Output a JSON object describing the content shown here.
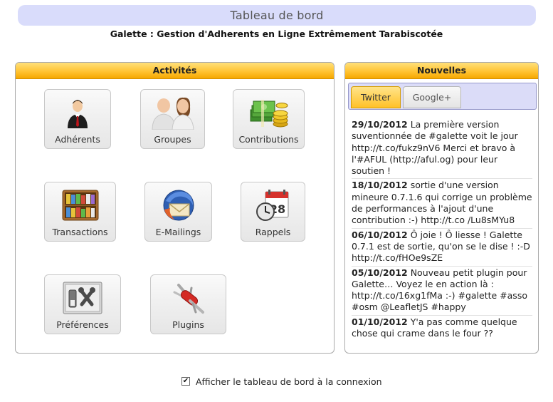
{
  "page": {
    "title": "Tableau de bord",
    "subtitle": "Galette : Gestion d'Adherents en Ligne Extrêmement Tarabiscotée"
  },
  "activities": {
    "title": "Activités",
    "tiles": [
      {
        "label": "Adhérents",
        "icon": "member-icon"
      },
      {
        "label": "Groupes",
        "icon": "groups-icon"
      },
      {
        "label": "Contributions",
        "icon": "contributions-icon"
      },
      {
        "label": "Transactions",
        "icon": "transactions-icon"
      },
      {
        "label": "E-Mailings",
        "icon": "email-icon"
      },
      {
        "label": "Rappels",
        "icon": "calendar-clock-icon"
      },
      {
        "label": "Préférences",
        "icon": "preferences-icon"
      },
      {
        "label": "Plugins",
        "icon": "plugins-icon"
      }
    ]
  },
  "news": {
    "title": "Nouvelles",
    "tabs": [
      {
        "label": "Twitter",
        "active": true
      },
      {
        "label": "Google+",
        "active": false
      }
    ],
    "items": [
      {
        "date": "29/10/2012",
        "text": "La première version suventionnée de #galette voit le jour http://t.co/fukz9nV6 Merci et bravo à l'#AFUL (http://aful.og) pour leur soutien !"
      },
      {
        "date": "18/10/2012",
        "text": "sortie d'une version mineure 0.7.1.6 qui corrige un problème de performances à l'ajout d'une contribution :-) http://t.co /Lu8sMYu8"
      },
      {
        "date": "06/10/2012",
        "text": "Ô joie ! Ô liesse ! Galette 0.7.1 est de sortie, qu'on se le dise ! :-D http://t.co/fHOe9sZE"
      },
      {
        "date": "05/10/2012",
        "text": "Nouveau petit plugin pour Galette… Voyez le en action là : http://t.co/16xg1fMa :-) #galette #asso #osm @LeafletJS #happy"
      },
      {
        "date": "01/10/2012",
        "text": "Y'a pas comme quelque chose qui crame dans le four ??"
      }
    ]
  },
  "footer": {
    "checkbox_label": "Afficher le tableau de bord à la connexion",
    "checked": true
  },
  "colors": {
    "header_gradient": "#ffc12e",
    "title_bar": "#d9dcfb",
    "tabs_bar": "#dbdcf8"
  }
}
